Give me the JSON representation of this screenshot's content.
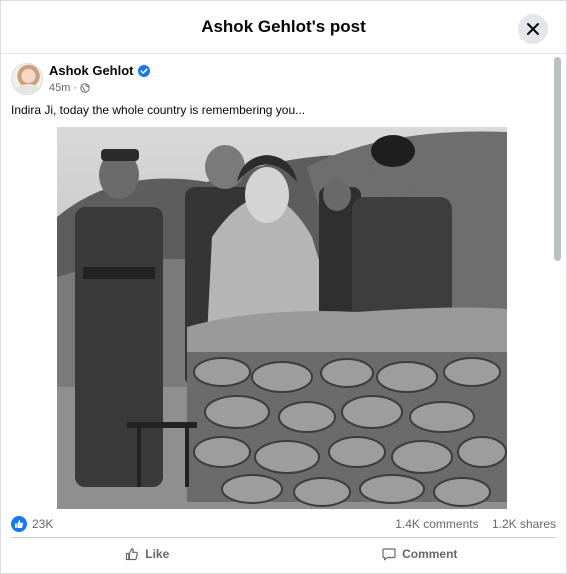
{
  "header": {
    "title": "Ashok Gehlot's post"
  },
  "post": {
    "author": "Ashok Gehlot",
    "time": "45m",
    "text": "Indira Ji, today the whole country is remembering you...",
    "icons": {
      "verified": "verified-badge-icon",
      "audience": "globe-icon"
    }
  },
  "stats": {
    "reactions": "23K",
    "comments": "1.4K comments",
    "shares": "1.2K shares"
  },
  "actions": {
    "like": "Like",
    "comment": "Comment"
  },
  "colors": {
    "accent": "#1877f2",
    "muted": "#65676b"
  }
}
